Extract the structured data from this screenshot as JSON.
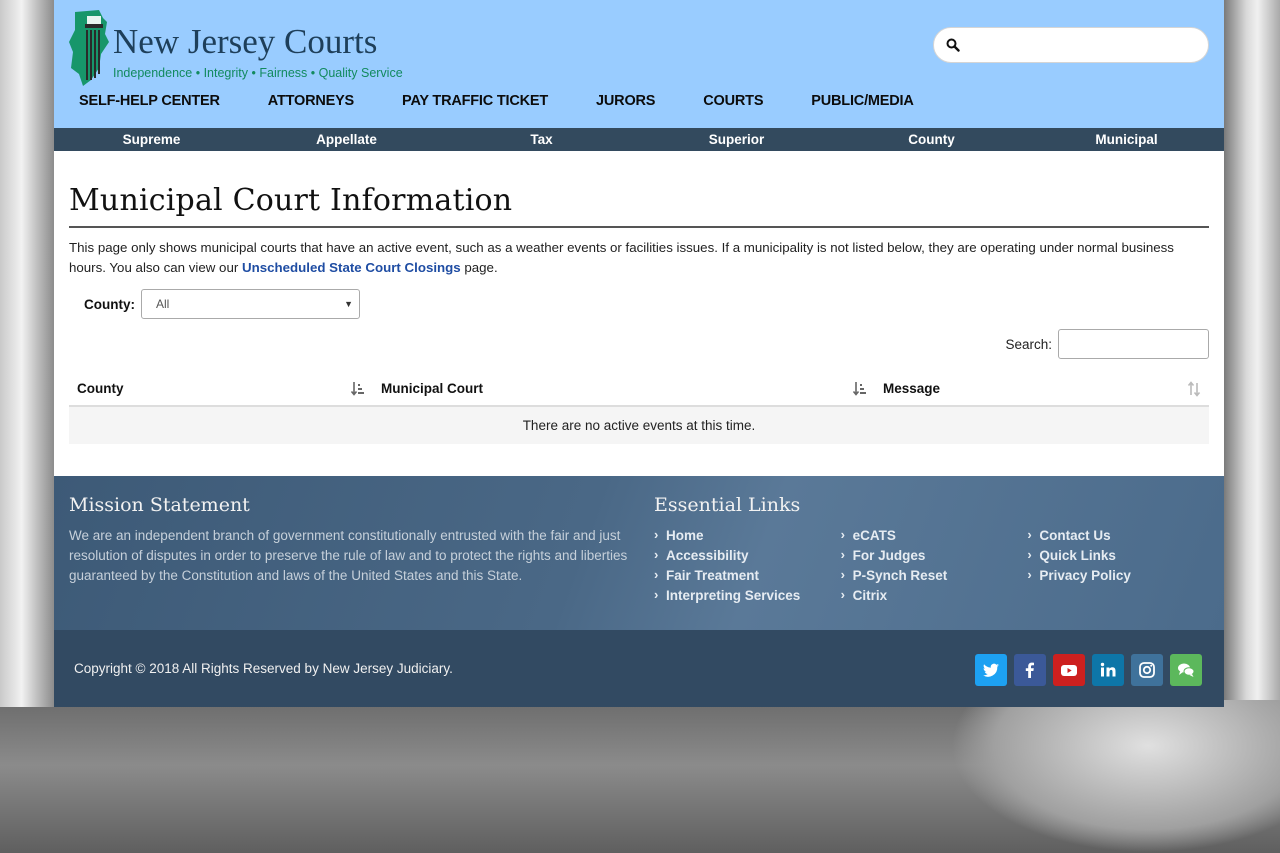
{
  "header": {
    "logo_title": "New Jersey Courts",
    "logo_tagline": "Independence • Integrity • Fairness • Quality Service",
    "search_placeholder": ""
  },
  "main_nav": [
    "SELF-HELP CENTER",
    "ATTORNEYS",
    "PAY TRAFFIC TICKET",
    "JURORS",
    "COURTS",
    "PUBLIC/MEDIA"
  ],
  "court_nav": [
    "Supreme",
    "Appellate",
    "Tax",
    "Superior",
    "County",
    "Municipal"
  ],
  "main": {
    "title": "Municipal Court Information",
    "intro_before": "This page only shows municipal courts that have an active event, such as a weather events or facilities issues. If a municipality is not listed below, they are operating under normal business hours. You also can view our ",
    "intro_link": "Unscheduled State Court Closings",
    "intro_after": " page.",
    "county_label": "County:",
    "county_selected": "All",
    "search_label": "Search:",
    "table": {
      "columns": [
        "County",
        "Municipal Court",
        "Message"
      ],
      "empty_message": "There are no active events at this time."
    }
  },
  "footer": {
    "mission_heading": "Mission Statement",
    "mission_text": "We are an independent branch of government constitutionally entrusted with the fair and just resolution of disputes in order to preserve the rule of law and to protect the rights and liberties guaranteed by the Constitution and laws of the United States and this State.",
    "links_heading": "Essential Links",
    "link_columns": [
      [
        "Home",
        "Accessibility",
        "Fair Treatment",
        "Interpreting Services"
      ],
      [
        "eCATS",
        "For Judges",
        "P-Synch Reset",
        "Citrix"
      ],
      [
        "Contact Us",
        "Quick Links",
        "Privacy Policy"
      ]
    ],
    "copyright": "Copyright © 2018 All Rights Reserved by New Jersey Judiciary."
  },
  "colors": {
    "header_bg": "#99ccff",
    "court_nav_bg": "#334a5e",
    "link_blue": "#1f4da3",
    "footer_bg": "#4a6886",
    "bottom_bar_bg": "#324a62"
  },
  "icons": {
    "search": "search-icon",
    "sort": "sort-icon",
    "socials": [
      "twitter-icon",
      "facebook-icon",
      "youtube-icon",
      "linkedin-icon",
      "instagram-icon",
      "chat-icon"
    ]
  }
}
